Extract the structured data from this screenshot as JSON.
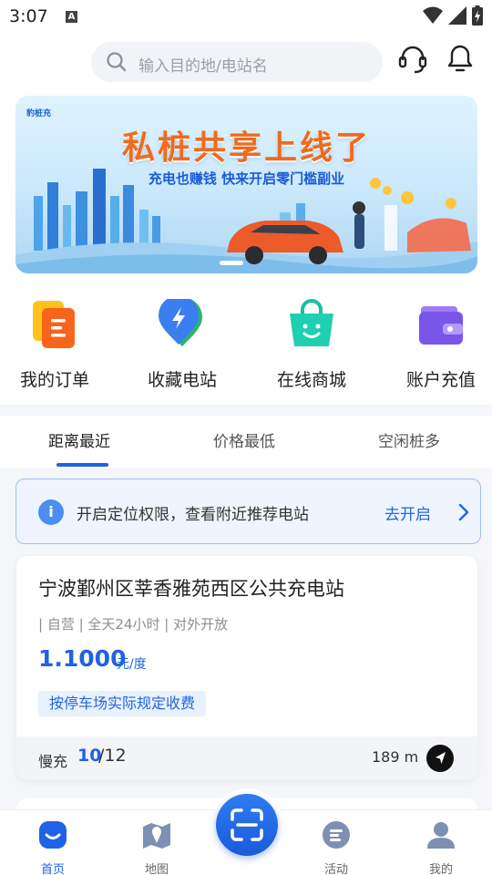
{
  "status": {
    "time": "3:07",
    "a_label": "A"
  },
  "search": {
    "placeholder": "输入目的地/电站名"
  },
  "banner": {
    "logo": "豹桩充",
    "headline": "私桩共享上线了",
    "subline": "充电也赚钱 快来开启零门槛副业"
  },
  "shortcuts": [
    {
      "label": "我的订单",
      "icon": "orders-icon"
    },
    {
      "label": "收藏电站",
      "icon": "favorite-station-icon"
    },
    {
      "label": "在线商城",
      "icon": "shop-icon"
    },
    {
      "label": "账户充值",
      "icon": "wallet-icon"
    }
  ],
  "tabs": [
    "距离最近",
    "价格最低",
    "空闲桩多"
  ],
  "notice": {
    "text": "开启定位权限，查看附近推荐电站",
    "action": "去开启"
  },
  "station": {
    "name": "宁波鄞州区莘香雅苑西区公共充电站",
    "tags": "| 自营 | 全天24小时 | 对外开放",
    "price": "1.1000",
    "unit": "元/度",
    "fee_note": "按停车场实际规定收费",
    "charge_type": "慢充",
    "available": "10",
    "total": "/12",
    "distance": "189 m"
  },
  "bottom_nav": [
    {
      "label": "首页",
      "icon": "home-icon"
    },
    {
      "label": "地图",
      "icon": "map-icon"
    },
    {
      "label": "活动",
      "icon": "activity-icon"
    },
    {
      "label": "我的",
      "icon": "profile-icon"
    }
  ],
  "colors": {
    "accent": "#1e62e6",
    "orange": "#f06a1e"
  }
}
